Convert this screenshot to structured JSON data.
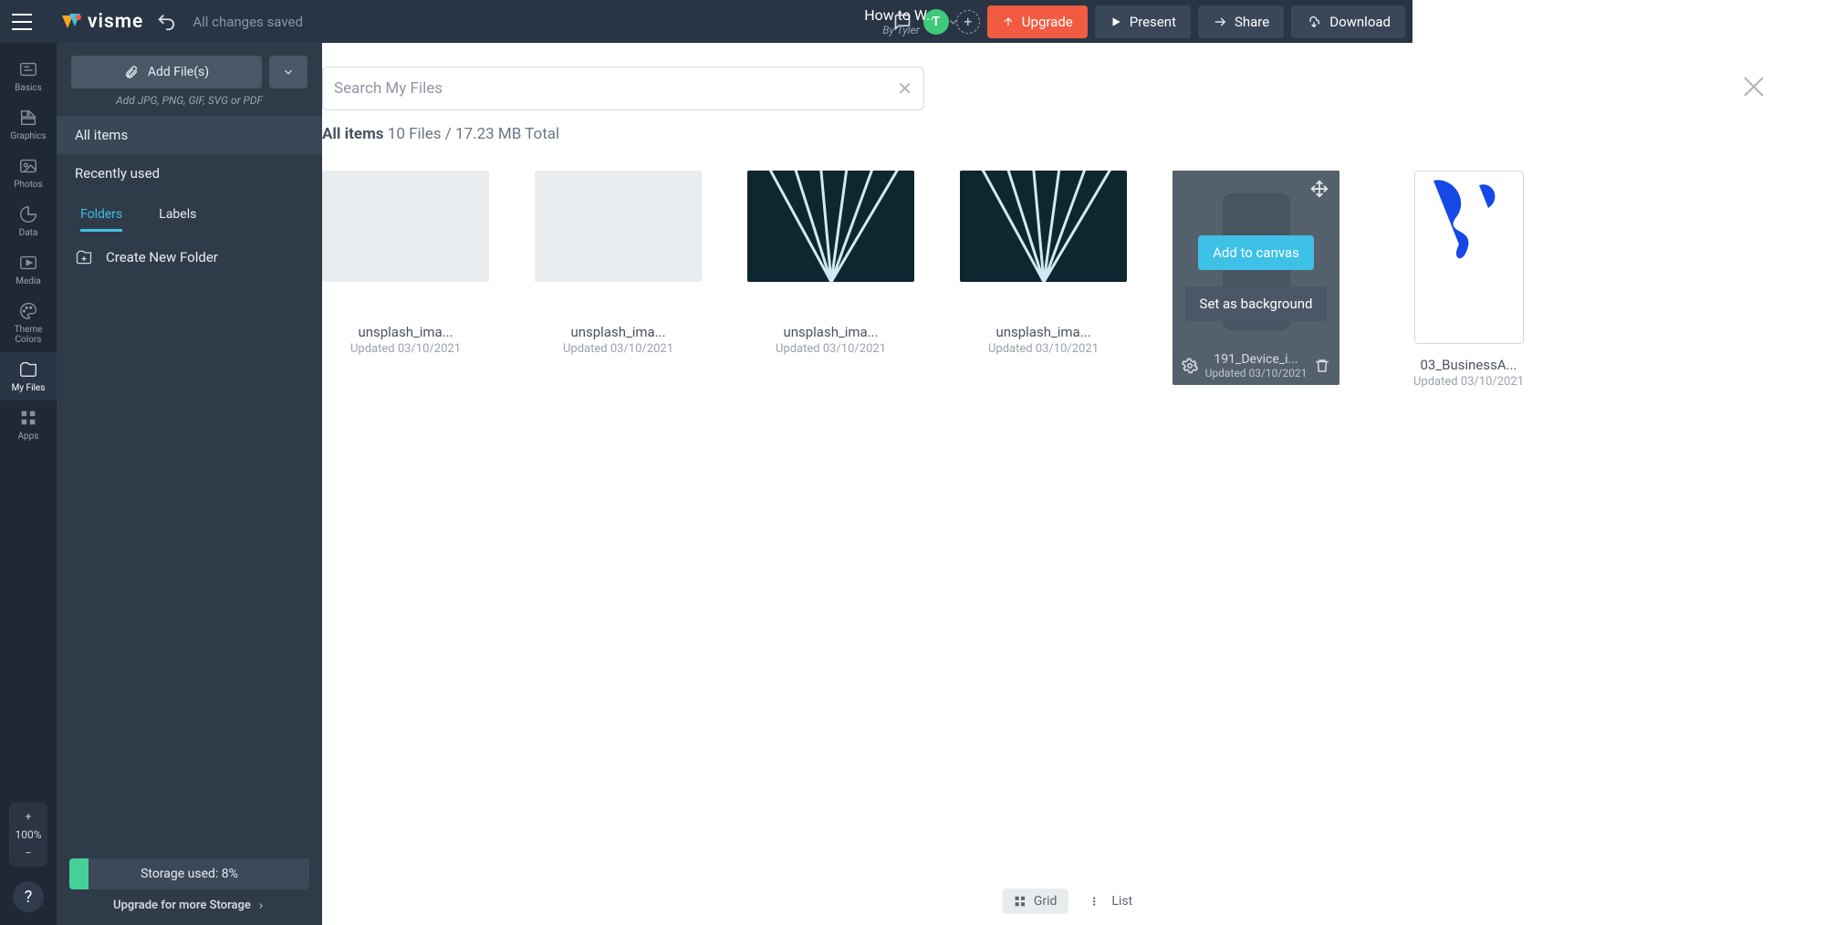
{
  "colors": {
    "accent": "#3ec1e6",
    "upgrade": "#f05b41",
    "avatar": "#3ec97b"
  },
  "topbar": {
    "logo_text": "visme",
    "save_status": "All changes saved",
    "title": "How to W...",
    "byline": "By Tyler",
    "avatar_initial": "T",
    "upgrade": "Upgrade",
    "present": "Present",
    "share": "Share",
    "download": "Download"
  },
  "rail": {
    "items": [
      {
        "label": "Basics"
      },
      {
        "label": "Graphics"
      },
      {
        "label": "Photos"
      },
      {
        "label": "Data"
      },
      {
        "label": "Media"
      },
      {
        "label": "Theme Colors"
      },
      {
        "label": "My Files"
      },
      {
        "label": "Apps"
      }
    ],
    "zoom": "100%"
  },
  "panel": {
    "add_files": "Add File(s)",
    "add_hint": "Add JPG, PNG, GIF, SVG or PDF",
    "nav": {
      "all_items": "All items",
      "recently_used": "Recently used"
    },
    "tabs": {
      "folders": "Folders",
      "labels": "Labels"
    },
    "create_folder": "Create New Folder",
    "storage_label": "Storage used: 8%",
    "storage_percent": 8,
    "upgrade_storage": "Upgrade for more Storage"
  },
  "main": {
    "search_placeholder": "Search My Files",
    "summary_label": "All items",
    "summary_detail": "10 Files / 17.23 MB Total",
    "view": {
      "grid": "Grid",
      "list": "List"
    },
    "hover": {
      "add_to_canvas": "Add to canvas",
      "set_as_background": "Set as background"
    },
    "files": [
      {
        "name": "unsplash_ima...",
        "date": "Updated 03/10/2021",
        "kind": "desk"
      },
      {
        "name": "unsplash_ima...",
        "date": "Updated 03/10/2021",
        "kind": "desk"
      },
      {
        "name": "unsplash_ima...",
        "date": "Updated 03/10/2021",
        "kind": "lines"
      },
      {
        "name": "unsplash_ima...",
        "date": "Updated 03/10/2021",
        "kind": "lines"
      },
      {
        "name": "191_Device_i...",
        "date": "Updated 03/10/2021",
        "kind": "device_hovered"
      },
      {
        "name": "03_BusinessA...",
        "date": "Updated 03/10/2021",
        "kind": "paint"
      }
    ]
  }
}
